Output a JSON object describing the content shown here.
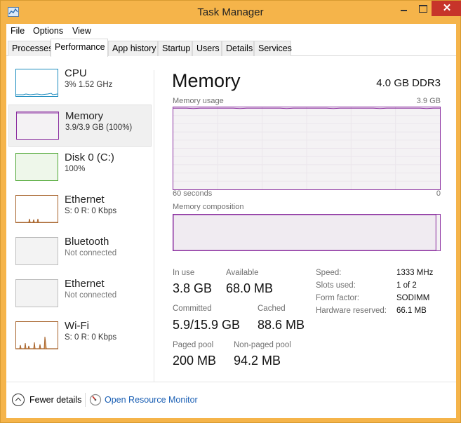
{
  "window": {
    "title": "Task Manager",
    "close_glyph": "✕"
  },
  "menu": {
    "file": "File",
    "options": "Options",
    "view": "View"
  },
  "tabs": [
    {
      "label": "Processes"
    },
    {
      "label": "Performance"
    },
    {
      "label": "App history"
    },
    {
      "label": "Startup"
    },
    {
      "label": "Users"
    },
    {
      "label": "Details"
    },
    {
      "label": "Services"
    }
  ],
  "active_tab": "Performance",
  "resources": [
    {
      "name": "CPU",
      "detail": "3%  1.52 GHz",
      "color": "#1a8bbe"
    },
    {
      "name": "Memory",
      "detail": "3.9/3.9 GB (100%)",
      "color": "#8b2fa0",
      "selected": true
    },
    {
      "name": "Disk 0 (C:)",
      "detail": "100%",
      "color": "#4da633"
    },
    {
      "name": "Ethernet",
      "detail": "S: 0  R: 0 Kbps",
      "color": "#a7632b"
    },
    {
      "name": "Bluetooth",
      "detail": "Not connected",
      "color": "#bdbdbd"
    },
    {
      "name": "Ethernet",
      "detail": "Not connected",
      "color": "#bdbdbd"
    },
    {
      "name": "Wi-Fi",
      "detail": "S: 0  R: 0 Kbps",
      "color": "#a7632b"
    }
  ],
  "detail": {
    "heading": "Memory",
    "spec": "4.0 GB DDR3",
    "usage_label": "Memory usage",
    "usage_max": "3.9 GB",
    "time_span": "60 seconds",
    "time_end": "0",
    "usage_fraction": 0.99,
    "composition_label": "Memory composition",
    "composition_in_use_fraction": 0.985
  },
  "stats": {
    "in_use_label": "In use",
    "in_use": "3.8 GB",
    "available_label": "Available",
    "available": "68.0 MB",
    "committed_label": "Committed",
    "committed": "5.9/15.9 GB",
    "cached_label": "Cached",
    "cached": "88.6 MB",
    "paged_label": "Paged pool",
    "paged": "200 MB",
    "nonpaged_label": "Non-paged pool",
    "nonpaged": "94.2 MB"
  },
  "specs": {
    "speed_label": "Speed:",
    "speed": "1333 MHz",
    "slots_label": "Slots used:",
    "slots": "1 of 2",
    "form_label": "Form factor:",
    "form": "SODIMM",
    "hw_label": "Hardware reserved:",
    "hw": "66.1 MB"
  },
  "footer": {
    "fewer": "Fewer details",
    "resmon": "Open Resource Monitor"
  },
  "colors": {
    "memory": "#8b2fa0",
    "titlebar": "#f5b44a",
    "close": "#c7342a",
    "link": "#1a5fb4"
  }
}
